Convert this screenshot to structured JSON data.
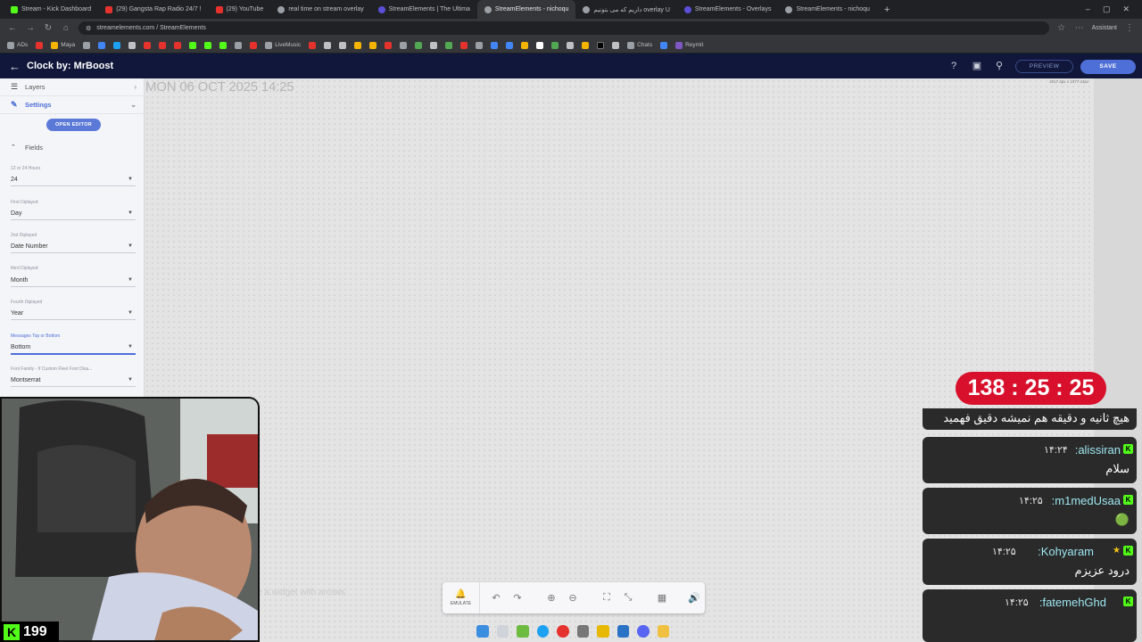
{
  "browser": {
    "tabs": [
      {
        "label": "Stream - Kick Dashboard",
        "color": "#53fc18"
      },
      {
        "label": "(29) Gangsta Rap Radio 24/7 !",
        "color": "#e5322d"
      },
      {
        "label": "(29) YouTube",
        "color": "#e5322d"
      },
      {
        "label": "real time on stream overlay",
        "color": "#9aa0a6"
      },
      {
        "label": "StreamElements | The Ultima",
        "color": "#5b4fd8"
      },
      {
        "label": "StreamElements - nichoqu",
        "color": "#9aa0a6"
      },
      {
        "label": "داریم که می‌ بتونیم overlay U",
        "color": "#9aa0a6"
      },
      {
        "label": "StreamElements - Overlays",
        "color": "#5b4fd8"
      },
      {
        "label": "StreamElements - nichoqu",
        "color": "#9aa0a6"
      }
    ],
    "url": "streamelements.com / StreamElements",
    "assistant_label": "Assistant",
    "bookmarks": [
      "ADs",
      "Maya",
      "LiveMusic",
      "Chats",
      "Reymit"
    ]
  },
  "header": {
    "title": "Clock by: MrBoost",
    "preview_label": "PREVIEW",
    "save_label": "SAVE"
  },
  "panel": {
    "layers_label": "Layers",
    "settings_label": "Settings",
    "open_editor_label": "OPEN EDITOR",
    "fields_label": "Fields",
    "fields": [
      {
        "label": "12 or 24 Hours",
        "value": "24"
      },
      {
        "label": "First Diplayed",
        "value": "Day"
      },
      {
        "label": "2nd Diplayed",
        "value": "Date Number"
      },
      {
        "label": "third Diplayed",
        "value": "Month"
      },
      {
        "label": "Fourth Diplayed",
        "value": "Year"
      },
      {
        "label": "Messages Top or Bottom",
        "value": "Bottom"
      },
      {
        "label": "Font Family - If Custom Fleet Font Disa...",
        "value": "Montserrat"
      }
    ]
  },
  "canvas": {
    "clock_text": "MON 06 OCT 2025 14:25",
    "dims_text": "1917.4px x 1077.24px",
    "hint_text": "e a widget with arrows"
  },
  "overlay": {
    "countdown": "138 : 25 : 25",
    "chat": [
      {
        "body": "هیچ ثانیه و دقیقه هم نمیشه دقیق فهمید"
      },
      {
        "user": "alissiran:",
        "time": "۱۴:۲۴",
        "body": "سلام"
      },
      {
        "user": "m1medUsaa:",
        "time": "۱۴:۲۵",
        "body": "🟢"
      },
      {
        "user": "Kohyaram:",
        "time": "۱۴:۲۵",
        "body": "درود عزیزم"
      },
      {
        "user": "fatemehGhd:",
        "time": "۱۴:۲۵",
        "body": ""
      }
    ],
    "viewer_count": "199"
  },
  "toolbar": {
    "emulate_label": "EMULATE"
  }
}
